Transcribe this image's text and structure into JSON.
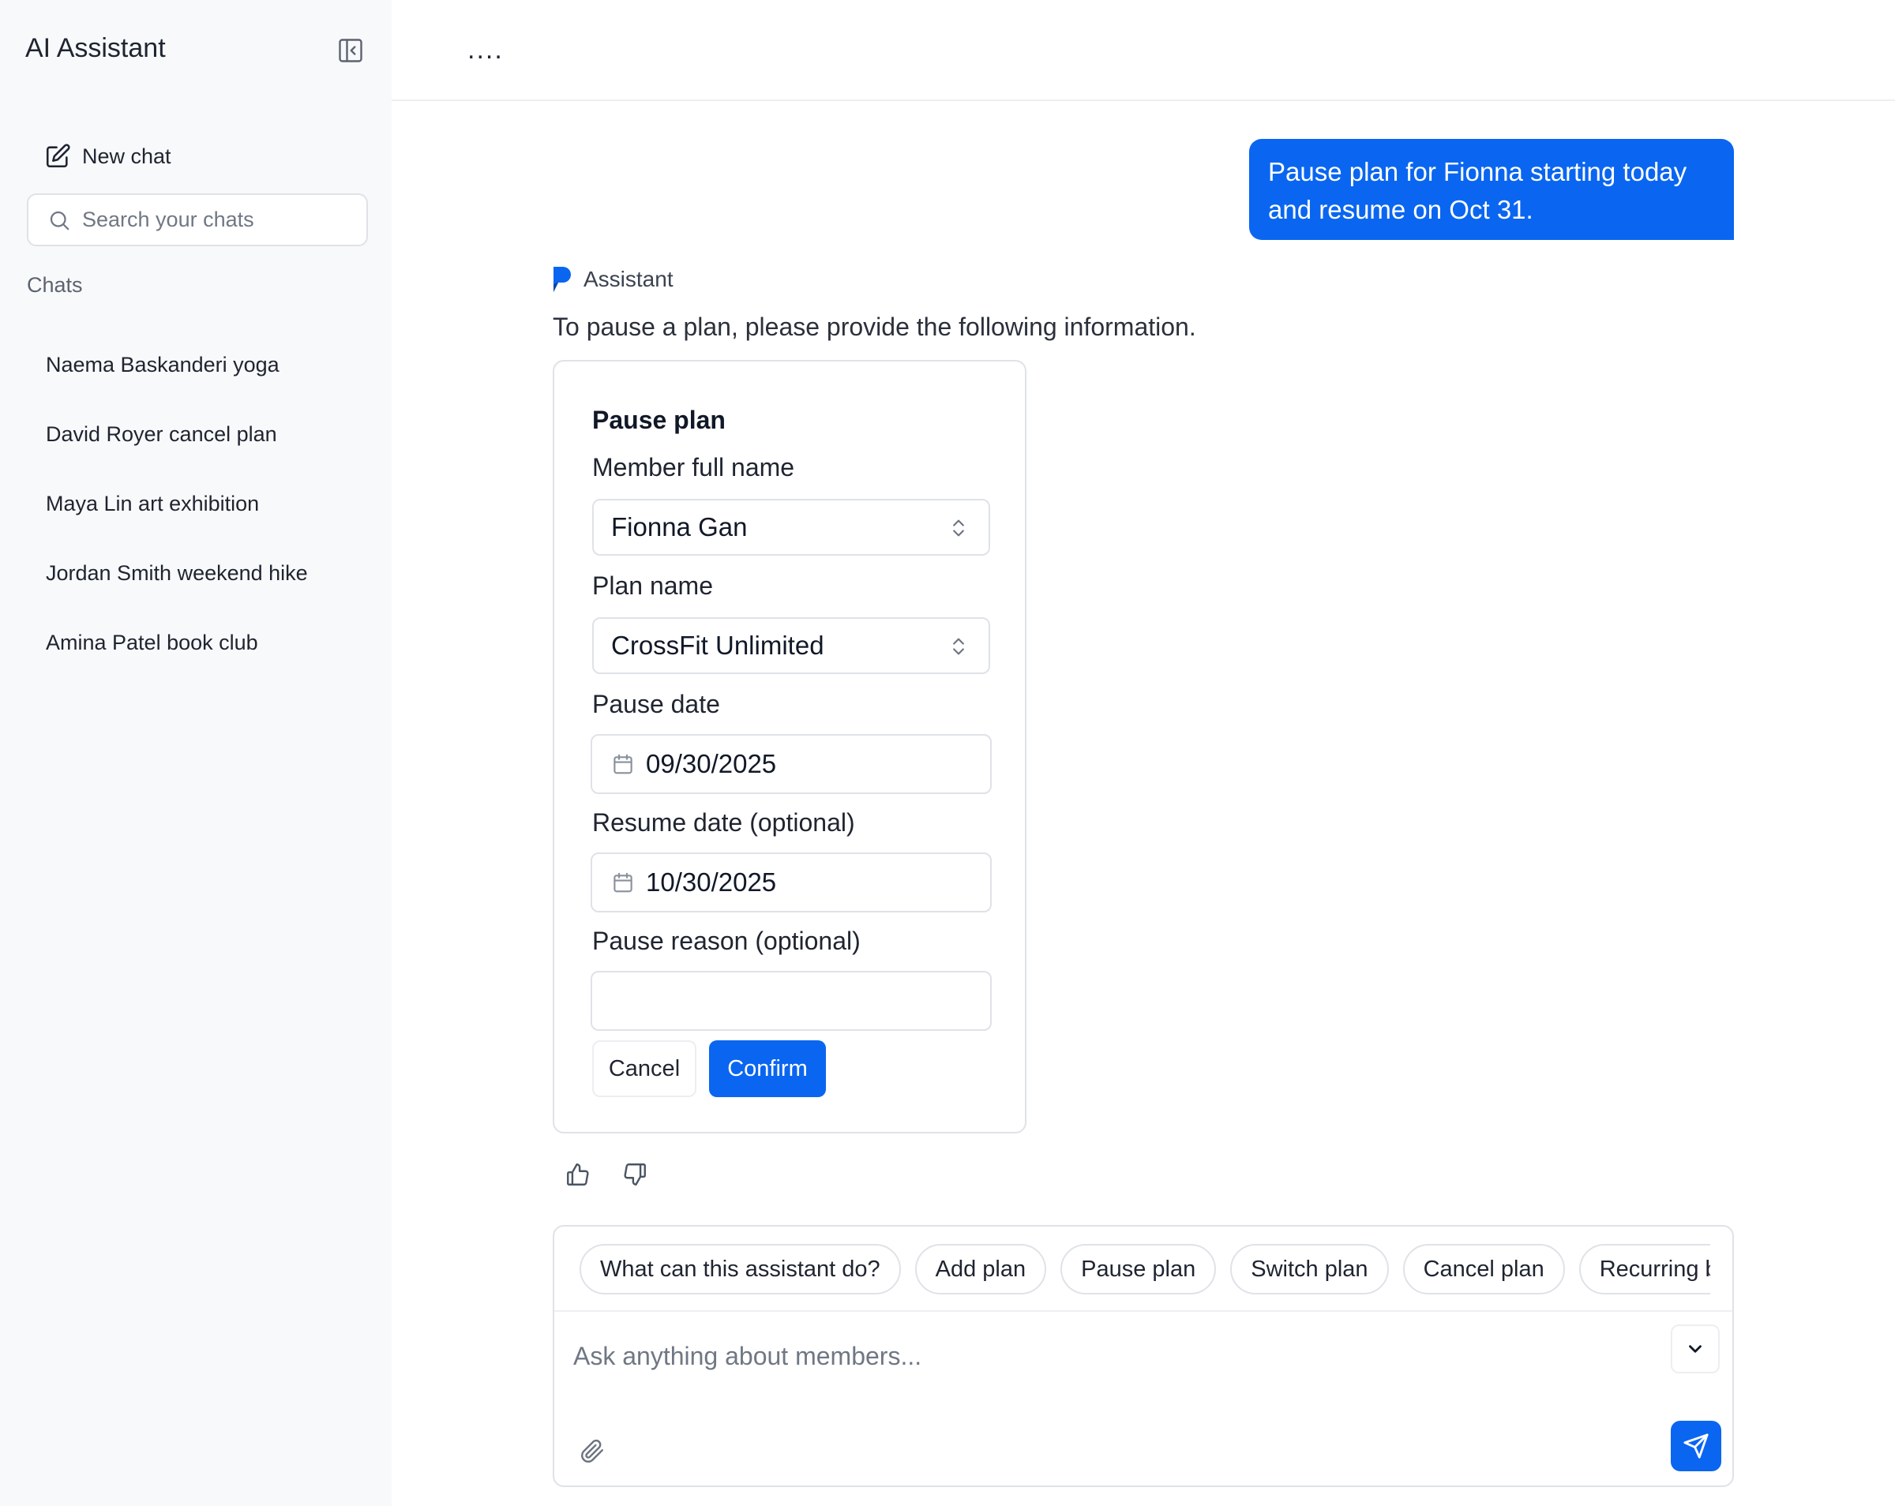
{
  "sidebar": {
    "app_title": "AI Assistant",
    "collapse_icon": "sidebar-collapse-icon",
    "new_chat_label": "New chat",
    "search_placeholder": "Search your chats",
    "chats_heading": "Chats",
    "chats": [
      {
        "label": "Naema Baskanderi yoga"
      },
      {
        "label": "David Royer cancel plan"
      },
      {
        "label": "Maya Lin art exhibition"
      },
      {
        "label": "Jordan Smith weekend hike"
      },
      {
        "label": "Amina Patel book club"
      }
    ]
  },
  "topbar": {
    "more_label": "...."
  },
  "conversation": {
    "user_message": "Pause plan for Fionna starting today and resume on Oct 31.",
    "assistant_name": "Assistant",
    "assistant_message": "To pause a plan, please provide the following information.",
    "form": {
      "title": "Pause plan",
      "member_label": "Member full name",
      "member_value": "Fionna Gan",
      "plan_label": "Plan name",
      "plan_value": "CrossFit Unlimited",
      "pause_date_label": "Pause date",
      "pause_date_value": "09/30/2025",
      "resume_date_label": "Resume date (optional)",
      "resume_date_value": "10/30/2025",
      "reason_label": "Pause reason (optional)",
      "reason_value": "",
      "cancel_label": "Cancel",
      "confirm_label": "Confirm"
    }
  },
  "composer": {
    "suggestions": [
      {
        "label": "What can this assistant do?"
      },
      {
        "label": "Add plan"
      },
      {
        "label": "Pause plan"
      },
      {
        "label": "Switch plan"
      },
      {
        "label": "Cancel plan"
      },
      {
        "label": "Recurring booking"
      }
    ],
    "placeholder": "Ask anything about members...",
    "value": ""
  },
  "colors": {
    "accent": "#0a66f0",
    "sidebar_bg": "#f8f9fa",
    "border": "#dfe2e7"
  }
}
